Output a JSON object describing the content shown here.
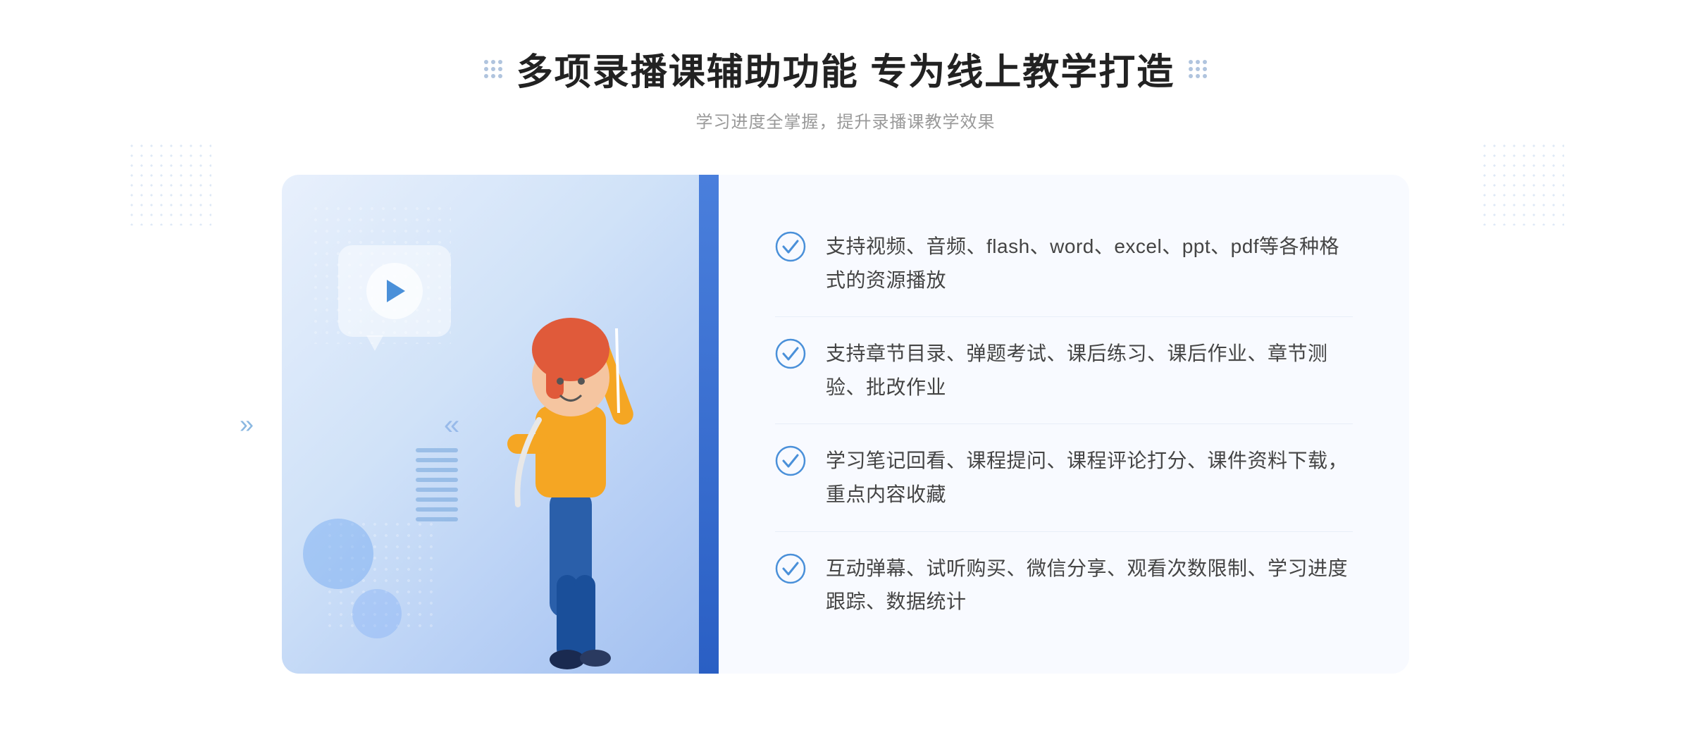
{
  "header": {
    "main_title": "多项录播课辅助功能 专为线上教学打造",
    "sub_title": "学习进度全掌握，提升录播课教学效果"
  },
  "features": [
    {
      "id": 1,
      "text": "支持视频、音频、flash、word、excel、ppt、pdf等各种格式的资源播放"
    },
    {
      "id": 2,
      "text": "支持章节目录、弹题考试、课后练习、课后作业、章节测验、批改作业"
    },
    {
      "id": 3,
      "text": "学习笔记回看、课程提问、课程评论打分、课件资料下载，重点内容收藏"
    },
    {
      "id": 4,
      "text": "互动弹幕、试听购买、微信分享、观看次数限制、学习进度跟踪、数据统计"
    }
  ],
  "decorative": {
    "play_icon": "▶",
    "left_chevron": "»",
    "check_color": "#4a90d9",
    "accent_color": "#3d7fd9"
  }
}
